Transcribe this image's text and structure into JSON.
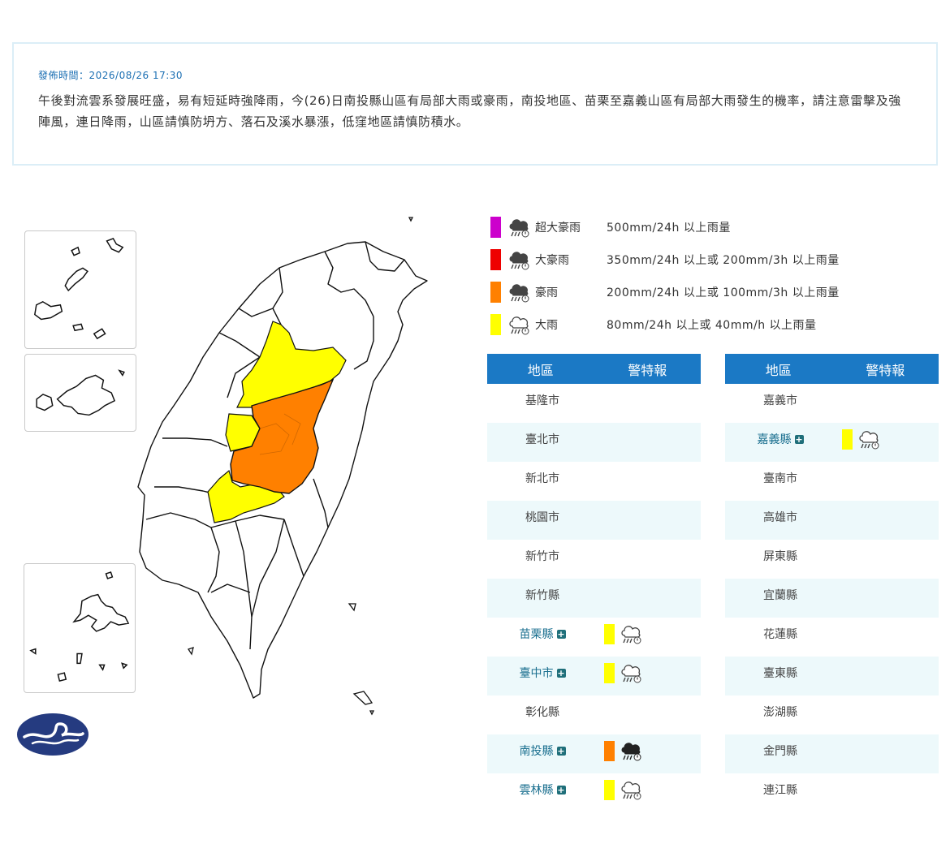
{
  "notice": {
    "time": "發佈時間：2026/08/26 17:30",
    "text": "午後對流雲系發展旺盛，易有短延時強降雨，今(26)日南投縣山區有局部大雨或豪雨，南投地區、苗栗至嘉義山區有局部大雨發生的機率，請注意雷擊及強陣風，連日降雨，山區請慎防坍方、落石及溪水暴漲，低窪地區請慎防積水。"
  },
  "colors": {
    "super_torrential": "#cc00cc",
    "extremely_torrential": "#ee0000",
    "torrential": "#ff8000",
    "heavy": "#ffff00",
    "header": "#1b79c5"
  },
  "legend": [
    {
      "name": "超大豪雨",
      "desc": "500mm/24h 以上雨量",
      "icon": "storm-rain-icon"
    },
    {
      "name": "大豪雨",
      "desc": "350mm/24h 以上或 200mm/3h 以上雨量",
      "icon": "storm-rain-icon"
    },
    {
      "name": "豪雨",
      "desc": "200mm/24h 以上或 100mm/3h 以上雨量",
      "icon": "storm-rain-icon"
    },
    {
      "name": "大雨",
      "desc": "80mm/24h 以上或 40mm/h 以上雨量",
      "icon": "rain-cloud-icon"
    }
  ],
  "table": {
    "header_region": "地區",
    "header_warning": "警特報",
    "left": [
      {
        "name": "基隆市",
        "level": ""
      },
      {
        "name": "臺北市",
        "level": ""
      },
      {
        "name": "新北市",
        "level": ""
      },
      {
        "name": "桃園市",
        "level": ""
      },
      {
        "name": "新竹市",
        "level": ""
      },
      {
        "name": "新竹縣",
        "level": ""
      },
      {
        "name": "苗栗縣",
        "level": "大雨"
      },
      {
        "name": "臺中市",
        "level": "大雨"
      },
      {
        "name": "彰化縣",
        "level": ""
      },
      {
        "name": "南投縣",
        "level": "豪雨"
      },
      {
        "name": "雲林縣",
        "level": "大雨"
      }
    ],
    "right": [
      {
        "name": "嘉義市",
        "level": ""
      },
      {
        "name": "嘉義縣",
        "level": "大雨"
      },
      {
        "name": "臺南市",
        "level": ""
      },
      {
        "name": "高雄市",
        "level": ""
      },
      {
        "name": "屏東縣",
        "level": ""
      },
      {
        "name": "宜蘭縣",
        "level": ""
      },
      {
        "name": "花蓮縣",
        "level": ""
      },
      {
        "name": "臺東縣",
        "level": ""
      },
      {
        "name": "澎湖縣",
        "level": ""
      },
      {
        "name": "金門縣",
        "level": ""
      },
      {
        "name": "連江縣",
        "level": ""
      }
    ]
  }
}
